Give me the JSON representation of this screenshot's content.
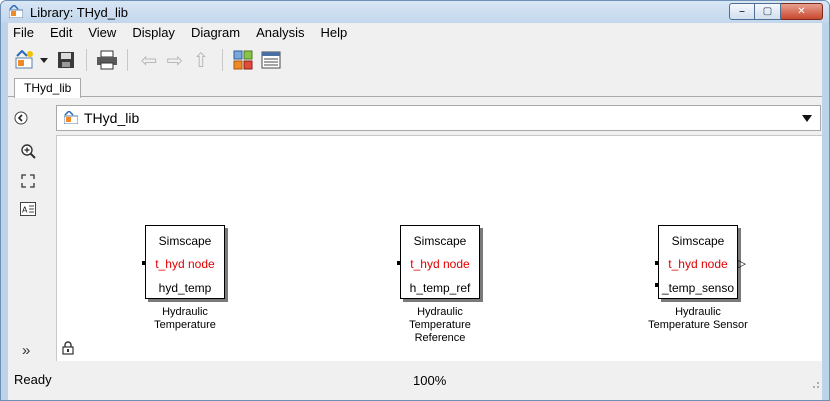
{
  "window": {
    "title": "Library: THyd_lib",
    "buttons": {
      "minimize": "–",
      "maximize": "▢",
      "close": "✕"
    }
  },
  "menu": [
    "File",
    "Edit",
    "View",
    "Display",
    "Diagram",
    "Analysis",
    "Help"
  ],
  "toolbar": {
    "icons": [
      "new-model-icon",
      "dropdown-arrow-icon",
      "save-icon",
      "print-icon",
      "back-arrow-icon",
      "forward-arrow-icon",
      "up-arrow-icon",
      "library-browser-icon",
      "model-explorer-icon"
    ]
  },
  "tab": {
    "label": "THyd_lib"
  },
  "address": {
    "path": "THyd_lib"
  },
  "left_tools": {
    "icons": [
      "zoom-in-icon",
      "fit-view-icon",
      "annotation-icon",
      "more-icon"
    ],
    "more_label": "»"
  },
  "blocks": [
    {
      "line1": "Simscape",
      "line2": "t_hyd node",
      "line3": "hyd_temp",
      "caption_lines": [
        "Hydraulic",
        "Temperature"
      ]
    },
    {
      "line1": "Simscape",
      "line2": "t_hyd node",
      "line3": "h_temp_ref",
      "caption_lines": [
        "Hydraulic",
        "Temperature",
        "Reference"
      ]
    },
    {
      "line1": "Simscape",
      "line2": "t_hyd node",
      "line3": "_temp_senso",
      "caption_lines": [
        "Hydraulic",
        "Temperature Sensor"
      ]
    }
  ],
  "status": {
    "left": "Ready",
    "zoom": "100%"
  },
  "colors": {
    "port_label": "#e00000",
    "window_frame": "#bcd3ea"
  }
}
